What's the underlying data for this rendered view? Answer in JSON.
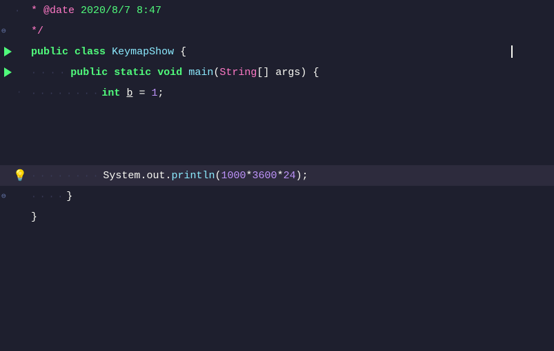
{
  "editor": {
    "background": "#1e1f2e",
    "lines": [
      {
        "id": "line-comment-date",
        "indent": "·",
        "content_html": "comment-star",
        "text": " * @date 2020/8/7 8:47",
        "has_fold": false,
        "has_run": false,
        "highlighted": false
      },
      {
        "id": "line-comment-end",
        "indent": "",
        "text": " */",
        "has_fold": true,
        "has_run": false,
        "highlighted": false
      },
      {
        "id": "line-class-decl",
        "indent": "",
        "text": "public class KeymapShow {",
        "has_fold": false,
        "has_run": true,
        "highlighted": false
      },
      {
        "id": "line-main-decl",
        "indent": "····",
        "text": "public static void main(String[] args) {",
        "has_fold": false,
        "has_run": true,
        "highlighted": false
      },
      {
        "id": "line-int-b",
        "indent": "········",
        "text": "int b = 1;",
        "has_fold": false,
        "has_run": false,
        "highlighted": false
      },
      {
        "id": "line-empty1",
        "indent": "",
        "text": "",
        "has_fold": false,
        "has_run": false,
        "highlighted": false
      },
      {
        "id": "line-empty2",
        "indent": "",
        "text": "",
        "has_fold": false,
        "has_run": false,
        "highlighted": false
      },
      {
        "id": "line-empty3",
        "indent": "",
        "text": "",
        "has_fold": false,
        "has_run": false,
        "highlighted": false
      },
      {
        "id": "line-println",
        "indent": "········",
        "text": "System.out.println(1000*3600*24);",
        "has_fold": false,
        "has_run": false,
        "highlighted": true,
        "has_bulb": true
      },
      {
        "id": "line-close-inner",
        "indent": "····",
        "text": "}",
        "has_fold": true,
        "has_run": false,
        "highlighted": false
      },
      {
        "id": "line-close-outer",
        "indent": "",
        "text": "}",
        "has_fold": false,
        "has_run": false,
        "highlighted": false
      }
    ]
  },
  "cursor": {
    "line": "line-class-decl",
    "visible": true
  },
  "colors": {
    "bg": "#1e1f2e",
    "highlighted_line": "#2d2b3d",
    "keyword": "#50fa7b",
    "type_name": "#8be9fd",
    "number": "#bd93f9",
    "comment": "#ff79c6",
    "default_text": "#f8f8f2",
    "gutter_text": "#6272a4",
    "dots": "#3d4060"
  }
}
